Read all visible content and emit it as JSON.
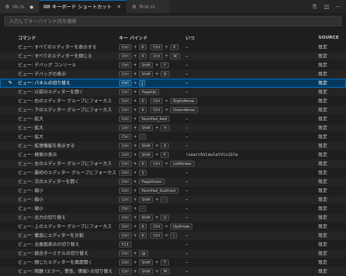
{
  "tabs": [
    {
      "label": "lib.rs",
      "icon": "rust-file-icon",
      "state": "modified"
    },
    {
      "label": "キーボード ショートカット",
      "icon": "keyboard-shortcuts-icon",
      "state": "active"
    },
    {
      "label": "first.rs",
      "icon": "rust-file-icon",
      "state": "normal"
    }
  ],
  "tab_actions": [
    {
      "name": "open-json-icon",
      "glyph": "⎘"
    },
    {
      "name": "split-editor-icon",
      "glyph": "◫"
    },
    {
      "name": "more-actions-icon",
      "glyph": "⋯"
    }
  ],
  "search": {
    "placeholder": "入力してキーバインド内を検索",
    "value": ""
  },
  "columns": {
    "command": "コマンド",
    "keybinding": "キー バインド",
    "when": "いつ",
    "source": "SOURCE"
  },
  "rows": [
    {
      "command": "ビュー: すべてのエディターを表示する",
      "keys": [
        [
          "Ctrl",
          "K"
        ],
        [
          "Ctrl",
          "P"
        ]
      ],
      "when": "—",
      "source": "既定"
    },
    {
      "command": "ビュー: すべてのエディターを閉じる",
      "keys": [
        [
          "Ctrl",
          "K"
        ],
        [
          "Ctrl",
          "W"
        ]
      ],
      "when": "—",
      "source": "既定"
    },
    {
      "command": "ビュー: デバッグ コンソール",
      "keys": [
        [
          "Ctrl",
          "Shift",
          "Y"
        ]
      ],
      "when": "—",
      "source": "既定"
    },
    {
      "command": "ビュー: デバッグの表示",
      "keys": [
        [
          "Ctrl",
          "Shift",
          "D"
        ]
      ],
      "when": "—",
      "source": "既定"
    },
    {
      "command": "ビュー: パネルの切り替え",
      "keys": [
        [
          "Ctrl",
          "J"
        ]
      ],
      "when": "—",
      "source": "既定",
      "selected": true
    },
    {
      "command": "ビュー: 以前のエディターを開く",
      "keys": [
        [
          "Ctrl",
          "PageUp"
        ]
      ],
      "when": "—",
      "source": "既定"
    },
    {
      "command": "ビュー: 右のエディター グループにフォーカス",
      "keys": [
        [
          "Ctrl",
          "K"
        ],
        [
          "Ctrl",
          "RightArrow"
        ]
      ],
      "when": "—",
      "source": "既定"
    },
    {
      "command": "ビュー: 下のエディター グループにフォーカス",
      "keys": [
        [
          "Ctrl",
          "K"
        ],
        [
          "Ctrl",
          "DownArrow"
        ]
      ],
      "when": "—",
      "source": "既定"
    },
    {
      "command": "ビュー: 拡大",
      "keys": [
        [
          "Ctrl",
          "NumPad_Add"
        ]
      ],
      "when": "—",
      "source": "既定"
    },
    {
      "command": "ビュー: 拡大",
      "keys": [
        [
          "Ctrl",
          "Shift",
          "="
        ]
      ],
      "when": "—",
      "source": "既定"
    },
    {
      "command": "ビュー: 拡大",
      "keys": [
        [
          "Ctrl",
          ";"
        ]
      ],
      "when": "—",
      "source": "既定"
    },
    {
      "command": "ビュー: 拡張機能を表示する",
      "keys": [
        [
          "Ctrl",
          "Shift",
          "X"
        ]
      ],
      "when": "—",
      "source": "既定"
    },
    {
      "command": "ビュー: 検索の表示",
      "keys": [
        [
          "Ctrl",
          "Shift",
          "F"
        ]
      ],
      "when": "!searchViewletVisible",
      "source": "既定"
    },
    {
      "command": "ビュー: 左のエディター グループにフォーカス",
      "keys": [
        [
          "Ctrl",
          "K"
        ],
        [
          "Ctrl",
          "LeftArrow"
        ]
      ],
      "when": "—",
      "source": "既定"
    },
    {
      "command": "ビュー: 最初のエディター グループにフォーカス",
      "keys": [
        [
          "Ctrl",
          "1"
        ]
      ],
      "when": "—",
      "source": "既定"
    },
    {
      "command": "ビュー: 次のエディターを開く",
      "keys": [
        [
          "Ctrl",
          "PageDown"
        ]
      ],
      "when": "—",
      "source": "既定"
    },
    {
      "command": "ビュー: 縮小",
      "keys": [
        [
          "Ctrl",
          "NumPad_Subtract"
        ]
      ],
      "when": "—",
      "source": "既定"
    },
    {
      "command": "ビュー: 縮小",
      "keys": [
        [
          "Ctrl",
          "Shift",
          "-"
        ]
      ],
      "when": "—",
      "source": "既定"
    },
    {
      "command": "ビュー: 縮小",
      "keys": [
        [
          "Ctrl",
          "-"
        ]
      ],
      "when": "—",
      "source": "既定"
    },
    {
      "command": "ビュー: 出力の切り替え",
      "keys": [
        [
          "Ctrl",
          "Shift",
          "U"
        ]
      ],
      "when": "—",
      "source": "既定"
    },
    {
      "command": "ビュー: 上のエディター グループにフォーカス",
      "keys": [
        [
          "Ctrl",
          "K"
        ],
        [
          "Ctrl",
          "UpArrow"
        ]
      ],
      "when": "—",
      "source": "既定"
    },
    {
      "command": "ビュー: 垂直にエディターを分割",
      "keys": [
        [
          "Ctrl",
          "K"
        ],
        [
          "Ctrl",
          "\\"
        ]
      ],
      "when": "—",
      "source": "既定"
    },
    {
      "command": "ビュー: 全画面表示の切り替え",
      "keys": [
        [
          "F11"
        ]
      ],
      "when": "—",
      "source": "既定"
    },
    {
      "command": "ビュー: 統合ターミナルの切り替え",
      "keys": [
        [
          "Ctrl",
          "@"
        ]
      ],
      "when": "—",
      "source": "既定"
    },
    {
      "command": "ビュー: 閉じたエディターを再度開く",
      "keys": [
        [
          "Ctrl",
          "Shift",
          "T"
        ]
      ],
      "when": "—",
      "source": "既定"
    },
    {
      "command": "ビュー: 問題 (エラー、警告、情報) の切り替え",
      "keys": [
        [
          "Ctrl",
          "Shift",
          "M"
        ]
      ],
      "when": "—",
      "source": "既定"
    }
  ],
  "colors": {
    "accent": "#0078d4",
    "selected_row": "#04395e",
    "background": "#1e1e1e"
  }
}
